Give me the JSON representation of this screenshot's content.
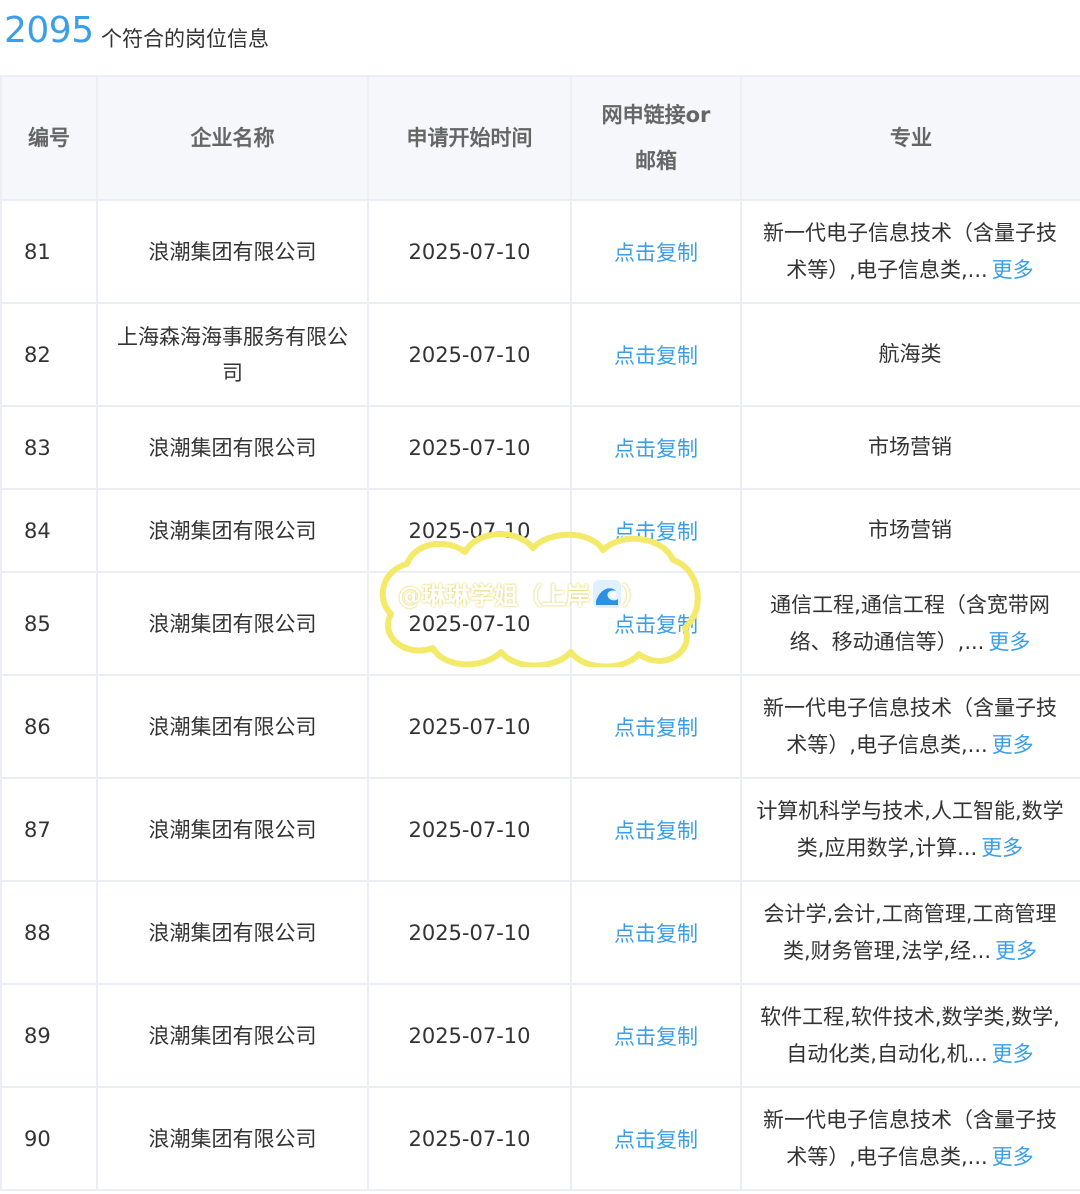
{
  "header": {
    "count": "2095",
    "count_label": "个符合的岗位信息"
  },
  "table": {
    "headers": {
      "num": "编号",
      "company": "企业名称",
      "start": "申请开始时间",
      "link_line1": "网申链接or",
      "link_line2": "邮箱",
      "major": "专业"
    },
    "rows": [
      {
        "num": "81",
        "company": "浪潮集团有限公司",
        "start": "2025-07-10",
        "link": "点击复制",
        "major": "新一代电子信息技术（含量子技术等）,电子信息类,...",
        "more": "更多"
      },
      {
        "num": "82",
        "company": "上海森海海事服务有限公司",
        "start": "2025-07-10",
        "link": "点击复制",
        "major": "航海类",
        "more": ""
      },
      {
        "num": "83",
        "company": "浪潮集团有限公司",
        "start": "2025-07-10",
        "link": "点击复制",
        "major": "市场营销",
        "more": ""
      },
      {
        "num": "84",
        "company": "浪潮集团有限公司",
        "start": "2025-07-10",
        "link": "点击复制",
        "major": "市场营销",
        "more": ""
      },
      {
        "num": "85",
        "company": "浪潮集团有限公司",
        "start": "2025-07-10",
        "link": "点击复制",
        "major": "通信工程,通信工程（含宽带网络、移动通信等）,...",
        "more": "更多"
      },
      {
        "num": "86",
        "company": "浪潮集团有限公司",
        "start": "2025-07-10",
        "link": "点击复制",
        "major": "新一代电子信息技术（含量子技术等）,电子信息类,...",
        "more": "更多"
      },
      {
        "num": "87",
        "company": "浪潮集团有限公司",
        "start": "2025-07-10",
        "link": "点击复制",
        "major": "计算机科学与技术,人工智能,数学类,应用数学,计算...",
        "more": "更多"
      },
      {
        "num": "88",
        "company": "浪潮集团有限公司",
        "start": "2025-07-10",
        "link": "点击复制",
        "major": "会计学,会计,工商管理,工商管理类,财务管理,法学,经...",
        "more": "更多"
      },
      {
        "num": "89",
        "company": "浪潮集团有限公司",
        "start": "2025-07-10",
        "link": "点击复制",
        "major": "软件工程,软件技术,数学类,数学,自动化类,自动化,机...",
        "more": "更多"
      },
      {
        "num": "90",
        "company": "浪潮集团有限公司",
        "start": "2025-07-10",
        "link": "点击复制",
        "major": "新一代电子信息技术（含量子技术等）,电子信息类,...",
        "more": "更多"
      }
    ]
  },
  "watermark": {
    "text": "@琳琳学姐（上岸",
    "text_end": "）",
    "icon": "wave-icon"
  },
  "colors": {
    "accent": "#3a9ee8",
    "header_bg": "#f5f7fa",
    "border": "#ebeef5",
    "watermark_outline": "#f3ea6a"
  }
}
